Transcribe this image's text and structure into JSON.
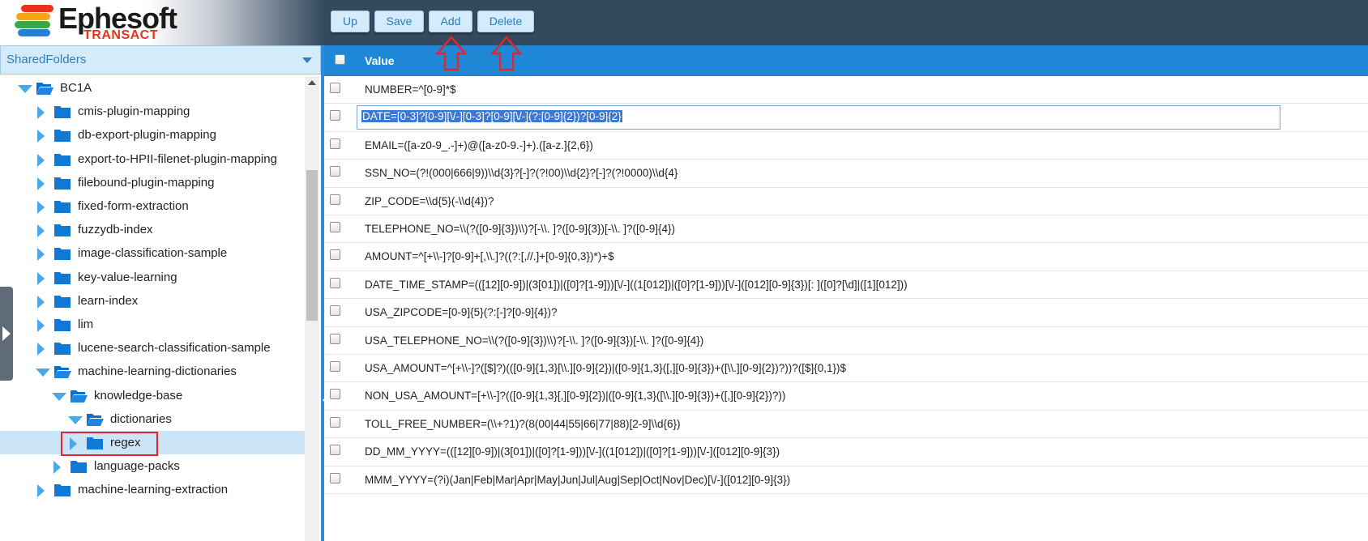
{
  "brand": {
    "name": "Ephesoft",
    "product": "TRANSACT",
    "stripe_colors": [
      "#e8331f",
      "#f2a81d",
      "#3aa84a",
      "#2a7fd4"
    ]
  },
  "toolbar": {
    "up": "Up",
    "save": "Save",
    "add": "Add",
    "delete": "Delete"
  },
  "annotation_color": "#e0262b",
  "left_panel": {
    "dropdown": "SharedFolders",
    "tree": [
      {
        "label": "BC1A",
        "level": 1,
        "state": "expanded"
      },
      {
        "label": "cmis-plugin-mapping",
        "level": 2,
        "state": "collapsed"
      },
      {
        "label": "db-export-plugin-mapping",
        "level": 2,
        "state": "collapsed"
      },
      {
        "label": "export-to-HPII-filenet-plugin-mapping",
        "level": 2,
        "state": "collapsed"
      },
      {
        "label": "filebound-plugin-mapping",
        "level": 2,
        "state": "collapsed"
      },
      {
        "label": "fixed-form-extraction",
        "level": 2,
        "state": "collapsed"
      },
      {
        "label": "fuzzydb-index",
        "level": 2,
        "state": "collapsed"
      },
      {
        "label": "image-classification-sample",
        "level": 2,
        "state": "collapsed"
      },
      {
        "label": "key-value-learning",
        "level": 2,
        "state": "collapsed"
      },
      {
        "label": "learn-index",
        "level": 2,
        "state": "collapsed"
      },
      {
        "label": "lim",
        "level": 2,
        "state": "collapsed"
      },
      {
        "label": "lucene-search-classification-sample",
        "level": 2,
        "state": "collapsed"
      },
      {
        "label": "machine-learning-dictionaries",
        "level": 2,
        "state": "expanded"
      },
      {
        "label": "knowledge-base",
        "level": 3,
        "state": "expanded"
      },
      {
        "label": "dictionaries",
        "level": 4,
        "state": "expanded"
      },
      {
        "label": "regex",
        "level": 5,
        "state": "collapsed",
        "selected": true
      },
      {
        "label": "language-packs",
        "level": 3,
        "state": "collapsed"
      },
      {
        "label": "machine-learning-extraction",
        "level": 2,
        "state": "collapsed"
      }
    ]
  },
  "table": {
    "column": "Value",
    "rows": [
      "NUMBER=^[0-9]*$",
      "DATE=[0-3]?[0-9][\\/-][0-3]?[0-9][\\/-](?:[0-9]{2})?[0-9]{2}",
      "EMAIL=([a-z0-9_.-]+)@([a-z0-9.-]+).([a-z.]{2,6})",
      "SSN_NO=(?!(000|666|9))\\\\d{3}?[-]?(?!00)\\\\d{2}?[-]?(?!0000)\\\\d{4}",
      "ZIP_CODE=\\\\d{5}(-\\\\d{4})?",
      "TELEPHONE_NO=\\\\(?([0-9]{3})\\\\)?[-\\\\. ]?([0-9]{3})[-\\\\. ]?([0-9]{4})",
      "AMOUNT=^[+\\\\-]?[0-9]+[,\\\\.]?((?:[,//.]+[0-9]{0,3})*)+$",
      "DATE_TIME_STAMP=(([12][0-9])|(3[01])|([0]?[1-9]))[\\/-]((1[012])|([0]?[1-9]))[\\/-]([012][0-9]{3})[: ]([0]?[\\d]|([1][012]))",
      "USA_ZIPCODE=[0-9]{5}(?:[-]?[0-9]{4})?",
      "USA_TELEPHONE_NO=\\\\(?([0-9]{3})\\\\)?[-\\\\. ]?([0-9]{3})[-\\\\. ]?([0-9]{4})",
      "USA_AMOUNT=^[+\\\\-]?([$]?)(([0-9]{1,3}[\\\\.][0-9]{2})|([0-9]{1,3}([,][0-9]{3})+([\\\\.][0-9]{2})?))?([$]{0,1})$",
      "NON_USA_AMOUNT=[+\\\\-]?(([0-9]{1,3}[,][0-9]{2})|([0-9]{1,3}([\\\\.][0-9]{3})+([,][0-9]{2})?))",
      "TOLL_FREE_NUMBER=(\\\\+?1)?(8(00|44|55|66|77|88)[2-9]\\\\d{6})",
      "DD_MM_YYYY=(([12][0-9])|(3[01])|([0]?[1-9]))[\\/-]((1[012])|([0]?[1-9]))[\\/-]([012][0-9]{3})",
      "MMM_YYYY=(?i)(Jan|Feb|Mar|Apr|May|Jun|Jul|Aug|Sep|Oct|Nov|Dec)[\\/-]([012][0-9]{3})"
    ],
    "editing_row": 1,
    "selection_color": "#3a78d3"
  }
}
